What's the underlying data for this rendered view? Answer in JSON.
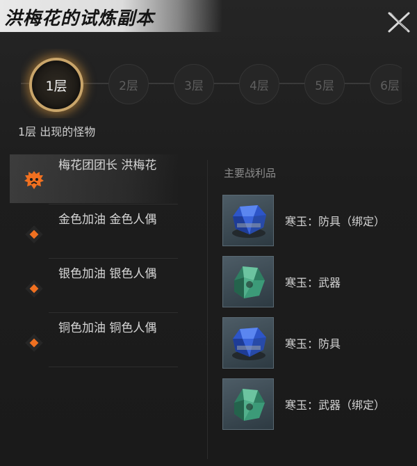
{
  "window": {
    "title": "洪梅花的试炼副本"
  },
  "floors": [
    {
      "label": "1层",
      "active": true
    },
    {
      "label": "2层",
      "active": false
    },
    {
      "label": "3层",
      "active": false
    },
    {
      "label": "4层",
      "active": false
    },
    {
      "label": "5层",
      "active": false
    },
    {
      "label": "6层",
      "active": false
    }
  ],
  "floor_caption": "1层 出现的怪物",
  "monsters": [
    {
      "name": "梅花团团长 洪梅花",
      "icon": "boss-lion-icon",
      "selected": true
    },
    {
      "name": "金色加油 金色人偶",
      "icon": "diamond-icon",
      "selected": false
    },
    {
      "name": "银色加油 银色人偶",
      "icon": "diamond-icon",
      "selected": false
    },
    {
      "name": "铜色加油 铜色人偶",
      "icon": "diamond-icon",
      "selected": false
    }
  ],
  "loot": {
    "title": "主要战利品",
    "items": [
      {
        "name": "寒玉：防具（绑定）",
        "icon": "blue-gem-icon"
      },
      {
        "name": "寒玉：武器",
        "icon": "green-gem-icon"
      },
      {
        "name": "寒玉：防具",
        "icon": "blue-gem-icon"
      },
      {
        "name": "寒玉：武器（绑定）",
        "icon": "green-gem-icon"
      }
    ]
  },
  "colors": {
    "accent_gold": "#c9a56a",
    "monster_orange": "#f07020",
    "blue_gem": "#2d55c8",
    "green_gem": "#3c9a78"
  }
}
